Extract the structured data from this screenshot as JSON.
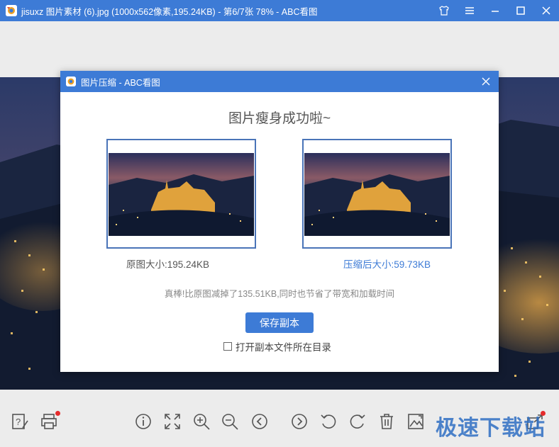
{
  "window": {
    "title": "jisuxz 图片素材 (6).jpg (1000x562像素,195.24KB) - 第6/7张 78% - ABC看图",
    "controls": [
      "skin-icon",
      "menu-icon",
      "minimize-icon",
      "maximize-icon",
      "close-icon"
    ]
  },
  "dialog": {
    "title": "图片压缩 - ABC看图",
    "headline": "图片瘦身成功啦~",
    "original_size_label": "原图大小:195.24KB",
    "compressed_size_label": "压缩后大小:59.73KB",
    "saved_note": "真棒!比原图减掉了135.51KB,同时也节省了带宽和加载时间",
    "save_copy_button": "保存副本",
    "open_dir_checkbox_label": "打开副本文件所在目录",
    "open_dir_checked": false
  },
  "toolbar": {
    "items": [
      "help-icon",
      "print-icon",
      "info-icon",
      "fit-icon",
      "zoom-in-icon",
      "zoom-out-icon",
      "previous-icon",
      "next-icon",
      "rotate-left-icon",
      "rotate-right-icon",
      "delete-icon",
      "edit-image-icon",
      "share-icon"
    ],
    "notification_badges": [
      "print-icon",
      "share-icon"
    ]
  },
  "watermark": "极速下载站",
  "colors": {
    "accent": "#3d7bd6",
    "compressed_label": "#3d7bd6",
    "notification": "#e52b2b"
  }
}
